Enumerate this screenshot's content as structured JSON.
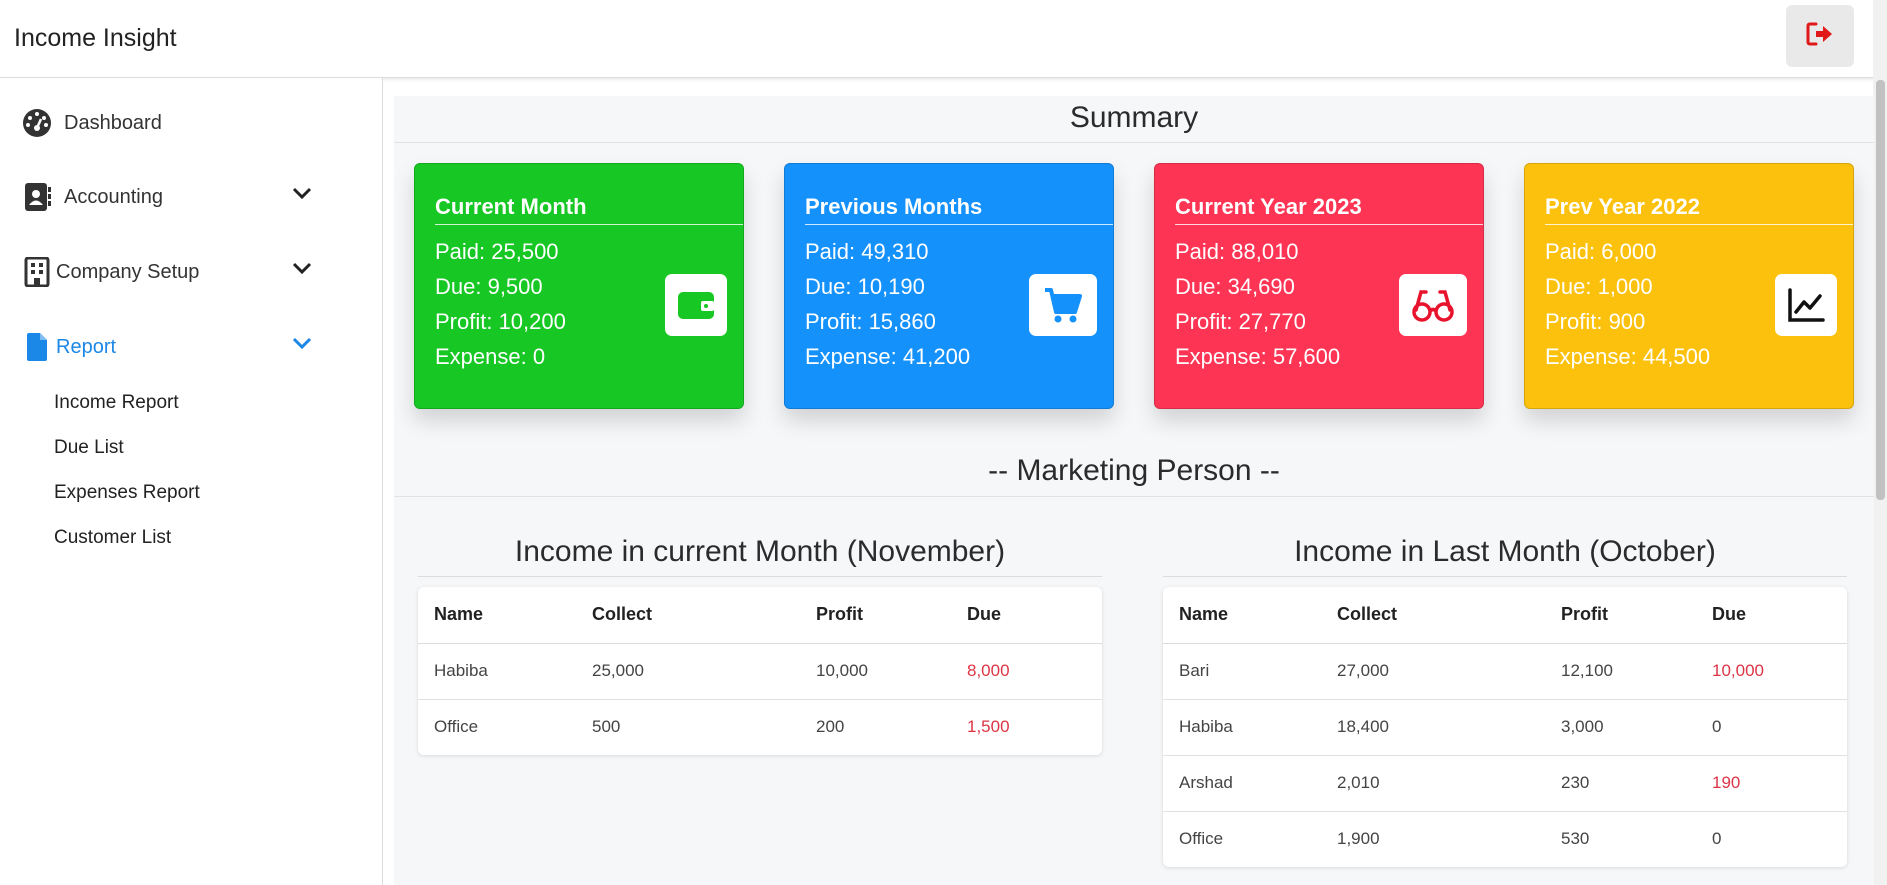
{
  "app": {
    "title": "Income Insight"
  },
  "header": {
    "logout_icon": "sign-out-icon",
    "logout_color": "#e01818"
  },
  "sidebar": {
    "items": [
      {
        "label": "Dashboard",
        "icon": "dashboard-gauge-icon"
      },
      {
        "label": "Accounting",
        "icon": "contact-book-icon"
      },
      {
        "label": "Company Setup",
        "icon": "building-icon"
      },
      {
        "label": "Report",
        "icon": "file-icon"
      }
    ],
    "report_subitems": [
      "Income Report",
      "Due List",
      "Expenses Report",
      "Customer List"
    ],
    "active_color": "#1b87e6"
  },
  "summary": {
    "title": "Summary",
    "cards": [
      {
        "title": "Current Month",
        "paid": "Paid: 25,500",
        "due": "Due: 9,500",
        "profit": "Profit: 10,200",
        "expense": "Expense: 0",
        "color": "#17c723",
        "icon": "wallet-icon"
      },
      {
        "title": "Previous Months",
        "paid": "Paid: 49,310",
        "due": "Due: 10,190",
        "profit": "Profit: 15,860",
        "expense": "Expense: 41,200",
        "color": "#1591fb",
        "icon": "cart-icon"
      },
      {
        "title": "Current Year 2023",
        "paid": "Paid: 88,010",
        "due": "Due: 34,690",
        "profit": "Profit: 27,770",
        "expense": "Expense: 57,600",
        "color": "#fd3454",
        "icon": "glasses-icon"
      },
      {
        "title": "Prev Year 2022",
        "paid": "Paid: 6,000",
        "due": "Due: 1,000",
        "profit": "Profit: 900",
        "expense": "Expense: 44,500",
        "color": "#fcc10d",
        "icon": "line-chart-icon"
      }
    ]
  },
  "marketing": {
    "title": "-- Marketing Person --",
    "current": {
      "title": "Income in current Month (November)",
      "headers": [
        "Name",
        "Collect",
        "Profit",
        "Due"
      ],
      "rows": [
        [
          "Habiba",
          "25,000",
          "10,000",
          "8,000"
        ],
        [
          "Office",
          "500",
          "200",
          "1,500"
        ]
      ]
    },
    "last": {
      "title": "Income in Last Month (October)",
      "headers": [
        "Name",
        "Collect",
        "Profit",
        "Due"
      ],
      "rows": [
        [
          "Bari",
          "27,000",
          "12,100",
          "10,000"
        ],
        [
          "Habiba",
          "18,400",
          "3,000",
          "0"
        ],
        [
          "Arshad",
          "2,010",
          "230",
          "190"
        ],
        [
          "Office",
          "1,900",
          "530",
          "0"
        ]
      ]
    }
  }
}
